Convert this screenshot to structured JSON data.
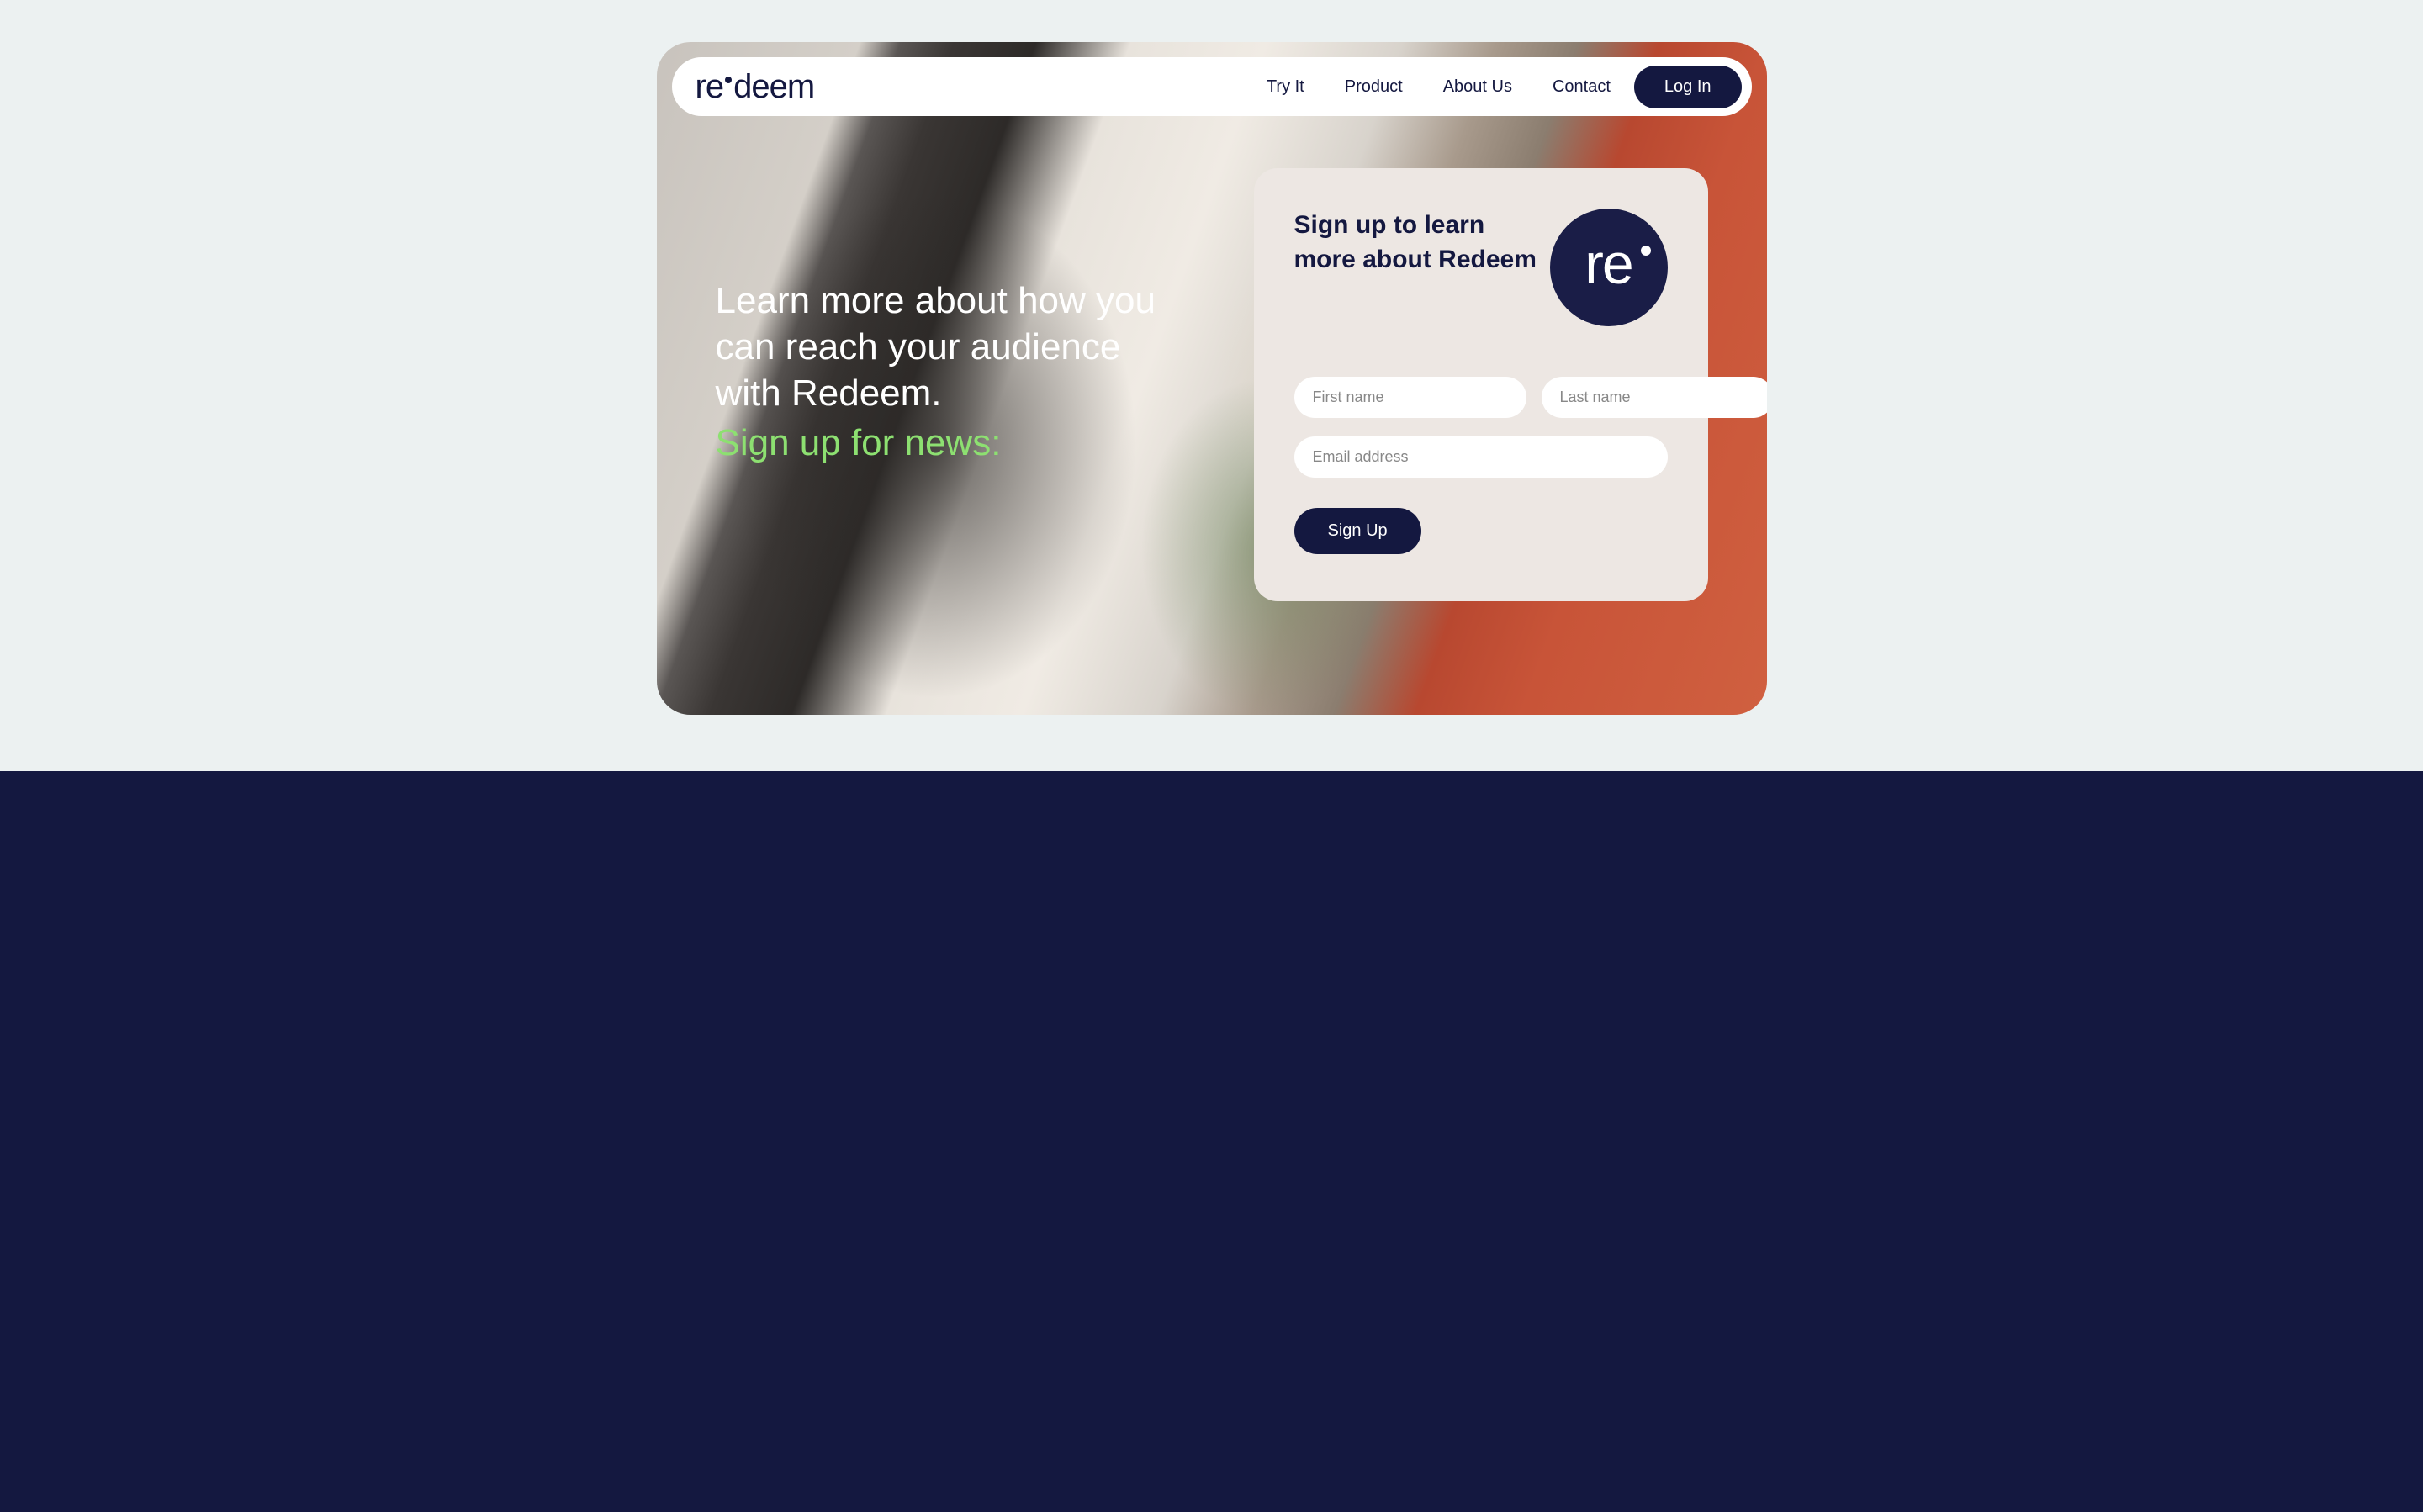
{
  "brand": {
    "logo_prefix": "re",
    "logo_suffix": "deem",
    "circle_text": "re"
  },
  "nav": {
    "items": [
      {
        "label": "Try It"
      },
      {
        "label": "Product"
      },
      {
        "label": "About Us"
      },
      {
        "label": "Contact"
      }
    ],
    "login_label": "Log In"
  },
  "hero": {
    "headline": "Learn more about how you can reach your audience with Redeem.",
    "cta": "Sign up for news:"
  },
  "signup": {
    "title": "Sign up to learn more about Redeem",
    "first_name_placeholder": "First name",
    "last_name_placeholder": "Last name",
    "email_placeholder": "Email address",
    "submit_label": "Sign Up"
  },
  "colors": {
    "brand_dark": "#141840",
    "accent_green": "#8de071",
    "card_bg": "#ede7e3",
    "page_bg": "#ecf1f1"
  }
}
